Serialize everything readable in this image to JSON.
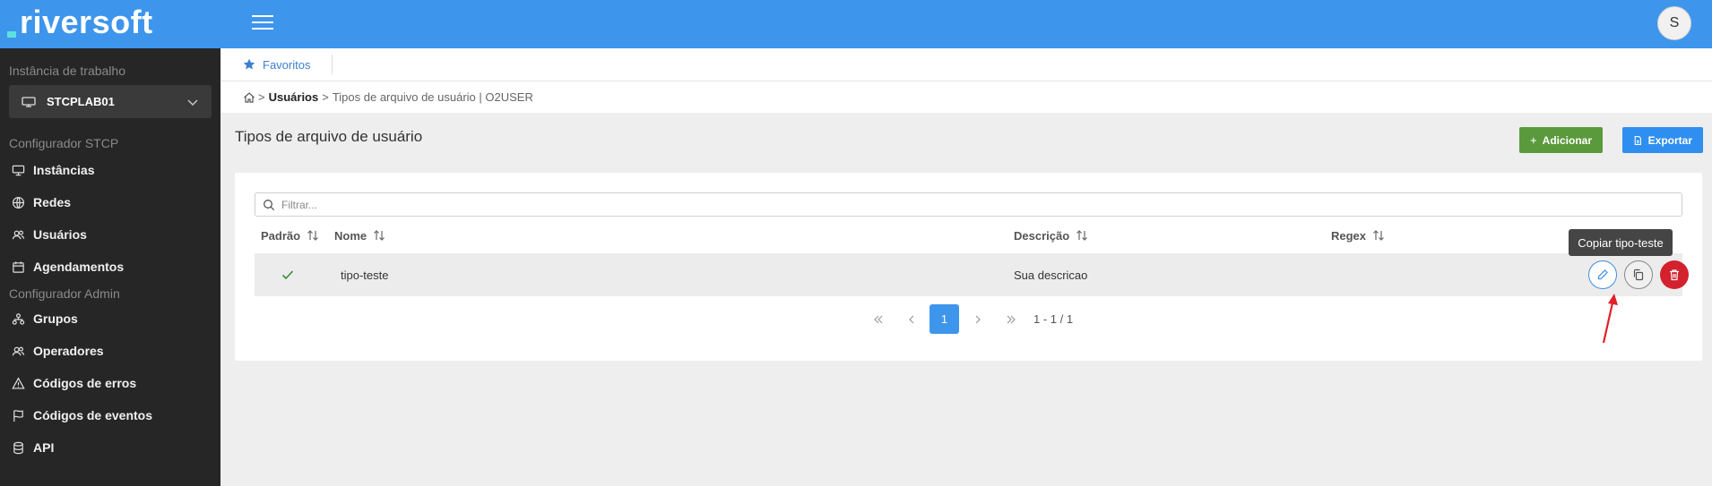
{
  "brand": {
    "name": "riversoft"
  },
  "sidebar": {
    "instance_label": "Instância de trabalho",
    "instance_value": "STCPLAB01",
    "section_stcp": "Configurador STCP",
    "stcp_items": [
      {
        "label": "Instâncias",
        "icon": "monitor-icon"
      },
      {
        "label": "Redes",
        "icon": "globe-icon"
      },
      {
        "label": "Usuários",
        "icon": "users-icon"
      },
      {
        "label": "Agendamentos",
        "icon": "calendar-icon"
      }
    ],
    "section_admin": "Configurador Admin",
    "admin_items": [
      {
        "label": "Grupos",
        "icon": "hierarchy-icon"
      },
      {
        "label": "Operadores",
        "icon": "users-icon"
      },
      {
        "label": "Códigos de erros",
        "icon": "warning-icon"
      },
      {
        "label": "Códigos de eventos",
        "icon": "flag-icon"
      },
      {
        "label": "API",
        "icon": "database-icon"
      }
    ]
  },
  "topbar": {
    "avatar_initial": "S"
  },
  "favorites": {
    "label": "Favoritos"
  },
  "breadcrumb": {
    "sep1": ">",
    "usuarios": "Usuários",
    "sep2": ">",
    "current": "Tipos de arquivo de usuário | O2USER"
  },
  "page": {
    "title": "Tipos de arquivo de usuário",
    "add_label": "Adicionar",
    "export_label": "Exportar"
  },
  "table": {
    "filter_placeholder": "Filtrar...",
    "columns": [
      "Padrão",
      "Nome",
      "Descrição",
      "Regex"
    ],
    "rows": [
      {
        "padrao": true,
        "nome": "tipo-teste",
        "descricao": "Sua descricao",
        "regex": ""
      }
    ],
    "tooltip": "Copiar tipo-teste"
  },
  "pagination": {
    "current_page": "1",
    "info": "1 - 1 / 1"
  },
  "colors": {
    "topbar": "#3e95ec",
    "sidebar": "#262626",
    "add_button": "#5b9a3c",
    "export_button": "#2f8ff0",
    "delete_button": "#d3212d",
    "annotation_arrow": "#e0202a"
  }
}
